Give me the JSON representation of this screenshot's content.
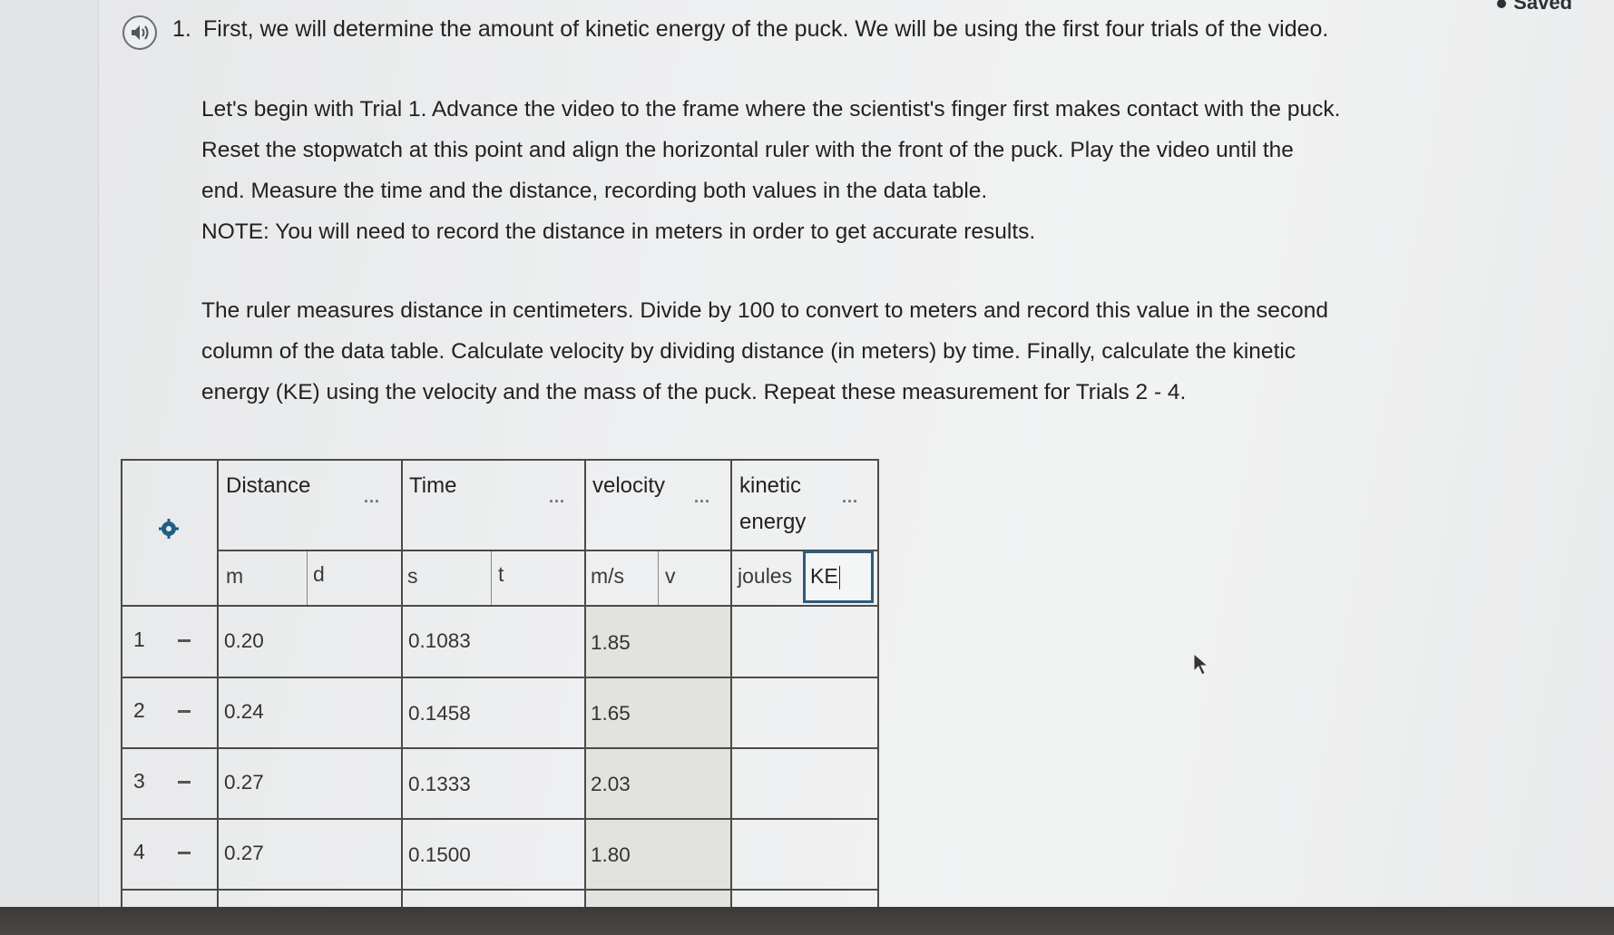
{
  "status": {
    "saved": "Saved"
  },
  "question": {
    "number": "1.",
    "title": "First, we will determine the amount of kinetic energy of the puck. We will be using the first four trials of the video.",
    "para1": [
      "Let's begin with Trial 1. Advance the video to the frame where the scientist's finger first makes contact with the puck.",
      "Reset the stopwatch at this point and align the horizontal ruler with the front of the puck. Play the video until the",
      "end. Measure the time and the distance, recording both values in the data table.",
      "NOTE: You will need to record the distance in meters in order to get accurate results."
    ],
    "para2": [
      "The ruler measures distance in centimeters. Divide by 100 to convert to meters and record this value in the second",
      "column of the data table. Calculate velocity by dividing distance (in meters) by time. Finally, calculate the kinetic",
      "energy (KE) using the velocity and the mass of the puck. Repeat these measurement for Trials 2 - 4."
    ]
  },
  "table": {
    "columns": [
      {
        "header": "Distance",
        "unit": "m",
        "var": "d"
      },
      {
        "header": "Time",
        "unit": "s",
        "var": "t"
      },
      {
        "header": "velocity",
        "unit": "m/s",
        "var": "v"
      },
      {
        "header_line1": "kinetic",
        "header_line2": "energy",
        "unit": "joules",
        "var": "KE"
      }
    ],
    "more_label": "...",
    "row_dash": "-",
    "rows": [
      {
        "num": "1",
        "distance": "0.20",
        "time": "0.1083",
        "velocity": "1.85",
        "ke": ""
      },
      {
        "num": "2",
        "distance": "0.24",
        "time": "0.1458",
        "velocity": "1.65",
        "ke": ""
      },
      {
        "num": "3",
        "distance": "0.27",
        "time": "0.1333",
        "velocity": "2.03",
        "ke": ""
      },
      {
        "num": "4",
        "distance": "0.27",
        "time": "0.1500",
        "velocity": "1.80",
        "ke": ""
      }
    ]
  },
  "colors": {
    "accent": "#2f5c7a",
    "settings_icon": "#1e5f86"
  }
}
